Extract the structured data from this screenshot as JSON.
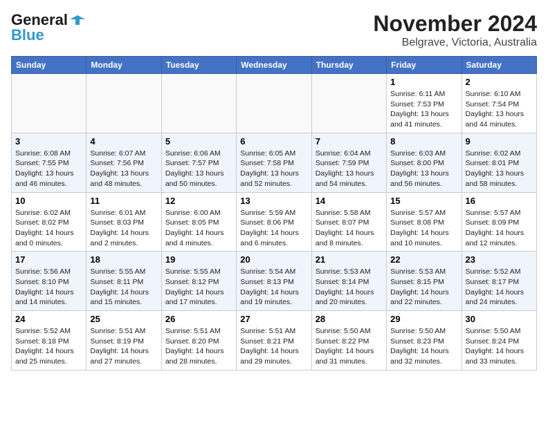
{
  "header": {
    "logo_line1": "General",
    "logo_line2": "Blue",
    "title": "November 2024",
    "subtitle": "Belgrave, Victoria, Australia"
  },
  "calendar": {
    "days_of_week": [
      "Sunday",
      "Monday",
      "Tuesday",
      "Wednesday",
      "Thursday",
      "Friday",
      "Saturday"
    ],
    "weeks": [
      [
        {
          "day": "",
          "info": ""
        },
        {
          "day": "",
          "info": ""
        },
        {
          "day": "",
          "info": ""
        },
        {
          "day": "",
          "info": ""
        },
        {
          "day": "",
          "info": ""
        },
        {
          "day": "1",
          "info": "Sunrise: 6:11 AM\nSunset: 7:53 PM\nDaylight: 13 hours\nand 41 minutes."
        },
        {
          "day": "2",
          "info": "Sunrise: 6:10 AM\nSunset: 7:54 PM\nDaylight: 13 hours\nand 44 minutes."
        }
      ],
      [
        {
          "day": "3",
          "info": "Sunrise: 6:08 AM\nSunset: 7:55 PM\nDaylight: 13 hours\nand 46 minutes."
        },
        {
          "day": "4",
          "info": "Sunrise: 6:07 AM\nSunset: 7:56 PM\nDaylight: 13 hours\nand 48 minutes."
        },
        {
          "day": "5",
          "info": "Sunrise: 6:06 AM\nSunset: 7:57 PM\nDaylight: 13 hours\nand 50 minutes."
        },
        {
          "day": "6",
          "info": "Sunrise: 6:05 AM\nSunset: 7:58 PM\nDaylight: 13 hours\nand 52 minutes."
        },
        {
          "day": "7",
          "info": "Sunrise: 6:04 AM\nSunset: 7:59 PM\nDaylight: 13 hours\nand 54 minutes."
        },
        {
          "day": "8",
          "info": "Sunrise: 6:03 AM\nSunset: 8:00 PM\nDaylight: 13 hours\nand 56 minutes."
        },
        {
          "day": "9",
          "info": "Sunrise: 6:02 AM\nSunset: 8:01 PM\nDaylight: 13 hours\nand 58 minutes."
        }
      ],
      [
        {
          "day": "10",
          "info": "Sunrise: 6:02 AM\nSunset: 8:02 PM\nDaylight: 14 hours\nand 0 minutes."
        },
        {
          "day": "11",
          "info": "Sunrise: 6:01 AM\nSunset: 8:03 PM\nDaylight: 14 hours\nand 2 minutes."
        },
        {
          "day": "12",
          "info": "Sunrise: 6:00 AM\nSunset: 8:05 PM\nDaylight: 14 hours\nand 4 minutes."
        },
        {
          "day": "13",
          "info": "Sunrise: 5:59 AM\nSunset: 8:06 PM\nDaylight: 14 hours\nand 6 minutes."
        },
        {
          "day": "14",
          "info": "Sunrise: 5:58 AM\nSunset: 8:07 PM\nDaylight: 14 hours\nand 8 minutes."
        },
        {
          "day": "15",
          "info": "Sunrise: 5:57 AM\nSunset: 8:08 PM\nDaylight: 14 hours\nand 10 minutes."
        },
        {
          "day": "16",
          "info": "Sunrise: 5:57 AM\nSunset: 8:09 PM\nDaylight: 14 hours\nand 12 minutes."
        }
      ],
      [
        {
          "day": "17",
          "info": "Sunrise: 5:56 AM\nSunset: 8:10 PM\nDaylight: 14 hours\nand 14 minutes."
        },
        {
          "day": "18",
          "info": "Sunrise: 5:55 AM\nSunset: 8:11 PM\nDaylight: 14 hours\nand 15 minutes."
        },
        {
          "day": "19",
          "info": "Sunrise: 5:55 AM\nSunset: 8:12 PM\nDaylight: 14 hours\nand 17 minutes."
        },
        {
          "day": "20",
          "info": "Sunrise: 5:54 AM\nSunset: 8:13 PM\nDaylight: 14 hours\nand 19 minutes."
        },
        {
          "day": "21",
          "info": "Sunrise: 5:53 AM\nSunset: 8:14 PM\nDaylight: 14 hours\nand 20 minutes."
        },
        {
          "day": "22",
          "info": "Sunrise: 5:53 AM\nSunset: 8:15 PM\nDaylight: 14 hours\nand 22 minutes."
        },
        {
          "day": "23",
          "info": "Sunrise: 5:52 AM\nSunset: 8:17 PM\nDaylight: 14 hours\nand 24 minutes."
        }
      ],
      [
        {
          "day": "24",
          "info": "Sunrise: 5:52 AM\nSunset: 8:18 PM\nDaylight: 14 hours\nand 25 minutes."
        },
        {
          "day": "25",
          "info": "Sunrise: 5:51 AM\nSunset: 8:19 PM\nDaylight: 14 hours\nand 27 minutes."
        },
        {
          "day": "26",
          "info": "Sunrise: 5:51 AM\nSunset: 8:20 PM\nDaylight: 14 hours\nand 28 minutes."
        },
        {
          "day": "27",
          "info": "Sunrise: 5:51 AM\nSunset: 8:21 PM\nDaylight: 14 hours\nand 29 minutes."
        },
        {
          "day": "28",
          "info": "Sunrise: 5:50 AM\nSunset: 8:22 PM\nDaylight: 14 hours\nand 31 minutes."
        },
        {
          "day": "29",
          "info": "Sunrise: 5:50 AM\nSunset: 8:23 PM\nDaylight: 14 hours\nand 32 minutes."
        },
        {
          "day": "30",
          "info": "Sunrise: 5:50 AM\nSunset: 8:24 PM\nDaylight: 14 hours\nand 33 minutes."
        }
      ]
    ]
  }
}
